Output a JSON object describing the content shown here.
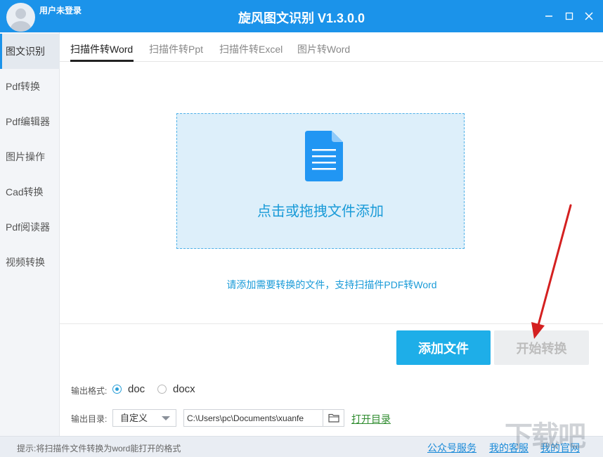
{
  "header": {
    "user": "用户未登录",
    "title": "旋风图文识别 V1.3.0.0"
  },
  "sidebar": {
    "items": [
      {
        "label": "图文识别"
      },
      {
        "label": "Pdf转换"
      },
      {
        "label": "Pdf编辑器"
      },
      {
        "label": "图片操作"
      },
      {
        "label": "Cad转换"
      },
      {
        "label": "Pdf阅读器"
      },
      {
        "label": "视频转换"
      }
    ]
  },
  "tabs": [
    {
      "label": "扫描件转Word"
    },
    {
      "label": "扫描件转Ppt"
    },
    {
      "label": "扫描件转Excel"
    },
    {
      "label": "图片转Word"
    }
  ],
  "dropzone": {
    "text": "点击或拖拽文件添加",
    "hint": "请添加需要转换的文件，支持扫描件PDF转Word"
  },
  "buttons": {
    "add": "添加文件",
    "start": "开始转换"
  },
  "output": {
    "format_label": "输出格式:",
    "formats": [
      {
        "label": "doc",
        "checked": true
      },
      {
        "label": "docx",
        "checked": false
      }
    ],
    "dir_label": "输出目录:",
    "dir_mode": "自定义",
    "path": "C:\\Users\\pc\\Documents\\xuanfe",
    "open_dir": "打开目录"
  },
  "status": {
    "tip": "提示:将扫描件文件转换为word能打开的格式",
    "links": [
      "公众号服务",
      "我的客服",
      "我的官网"
    ]
  },
  "watermark": "下载吧",
  "colors": {
    "titlebar": "#1b93ea",
    "accent": "#1eaee8",
    "dropzone_bg": "#ddeffa",
    "annotation_arrow": "#d42020"
  }
}
